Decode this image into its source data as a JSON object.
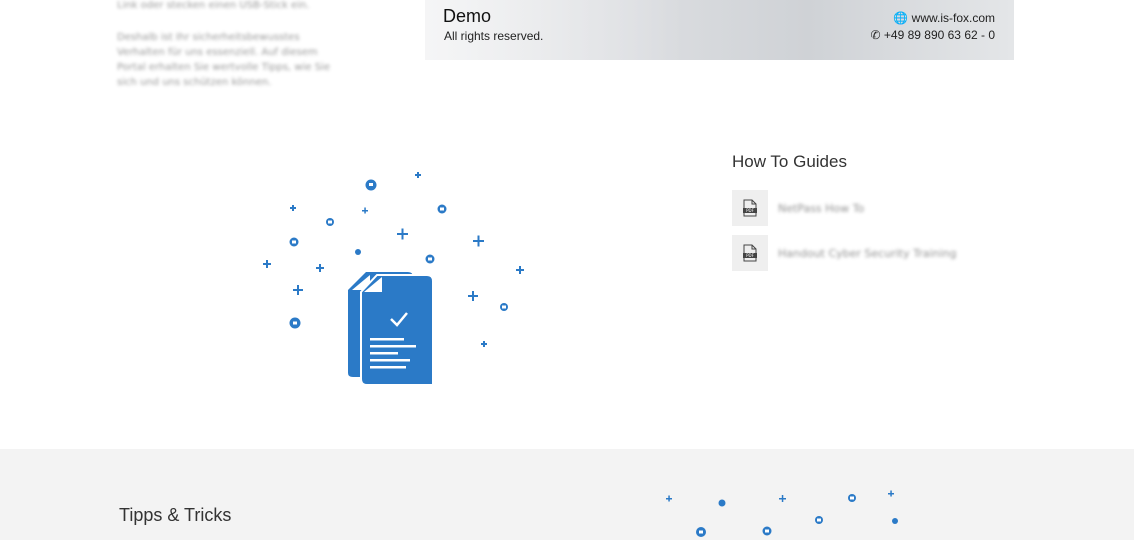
{
  "intro": {
    "line_top": "Link oder stecken einen USB-Stick ein.",
    "paragraph": "Deshalb ist Ihr sicherheitsbewusstes Verhalten für uns essenziell. Auf diesem Portal erhalten Sie wertvolle Tipps, wie Sie sich und uns schützen können."
  },
  "banner": {
    "title": "Demo",
    "subtitle": "All rights reserved.",
    "website": "www.is-fox.com",
    "phone": "+49 89 890 63 62 - 0",
    "icons": [
      "globe-icon",
      "phone-icon"
    ]
  },
  "guides": {
    "title": "How To Guides",
    "items": [
      {
        "label": "NetPass How To",
        "icon": "pdf-icon"
      },
      {
        "label": "Handout Cyber Security Training",
        "icon": "pdf-icon"
      }
    ]
  },
  "tips": {
    "title": "Tipps & Tricks"
  },
  "colors": {
    "accent": "#2b7ac7",
    "grey_band": "#f3f3f3"
  }
}
